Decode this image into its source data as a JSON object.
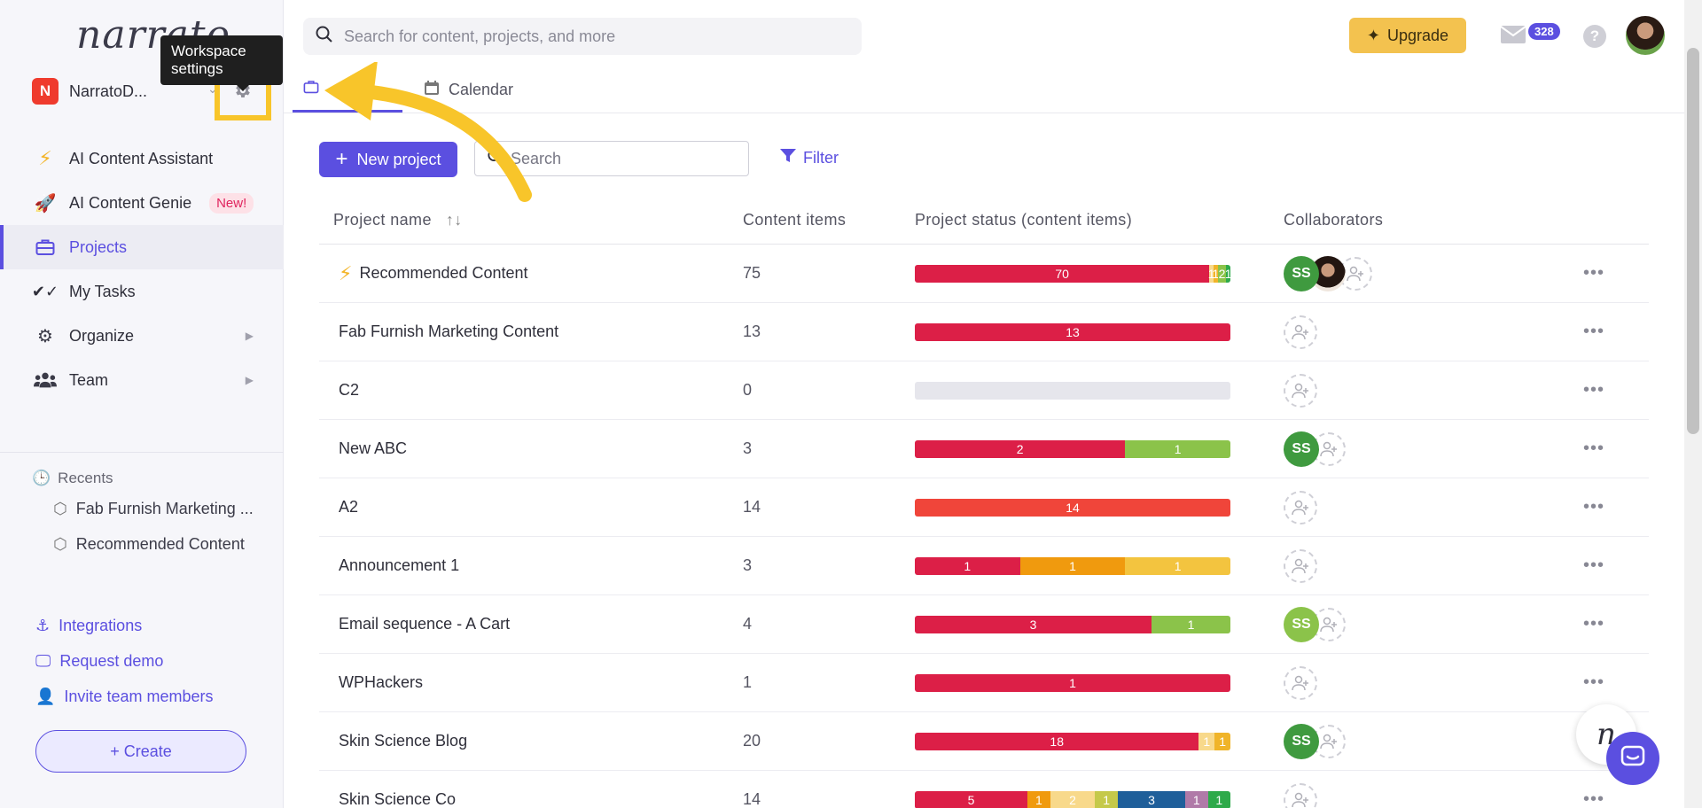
{
  "app": {
    "logo": "narrato"
  },
  "workspace": {
    "badge": "N",
    "name": "NarratoD...",
    "tooltip": "Workspace settings"
  },
  "sidebar": {
    "items": [
      {
        "label": "AI Content Assistant",
        "icon": "lightning-icon"
      },
      {
        "label": "AI Content Genie",
        "icon": "rocket-icon",
        "badge": "New!"
      },
      {
        "label": "Projects",
        "icon": "briefcase-icon",
        "active": true
      },
      {
        "label": "My Tasks",
        "icon": "checks-icon"
      },
      {
        "label": "Organize",
        "icon": "gears-icon"
      },
      {
        "label": "Team",
        "icon": "team-icon"
      }
    ],
    "recents_title": "Recents",
    "recents": [
      "Fab Furnish Marketing ...",
      "Recommended Content"
    ],
    "bottom_links": [
      "Integrations",
      "Request demo",
      "Invite team members"
    ],
    "create_label": "+ Create"
  },
  "topbar": {
    "search_placeholder": "Search for content, projects, and more",
    "upgrade_label": "Upgrade",
    "mail_count": "328",
    "help": "?"
  },
  "tabs": {
    "calendar": "Calendar"
  },
  "toolbar": {
    "new_project": "New project",
    "search_placeholder": "Search",
    "filter": "Filter"
  },
  "table": {
    "headers": {
      "name": "Project name",
      "count": "Content items",
      "status": "Project status (content items)",
      "collab": "Collaborators"
    },
    "rows": [
      {
        "name": "Recommended Content",
        "lightning": true,
        "count": "75",
        "segments": [
          {
            "v": 70,
            "label": "70",
            "color": "#dc1f47"
          },
          {
            "v": 1,
            "label": "1",
            "color": "#f8d98b"
          },
          {
            "v": 1,
            "label": "1",
            "color": "#f0b429"
          },
          {
            "v": 2,
            "label": "2",
            "color": "#8bc34a"
          },
          {
            "v": 1,
            "label": "1",
            "color": "#2eaa4a"
          }
        ],
        "collab": {
          "initials": "SS",
          "color": "#3f9a3f",
          "photo": true
        }
      },
      {
        "name": "Fab Furnish Marketing Content",
        "count": "13",
        "segments": [
          {
            "v": 13,
            "label": "13",
            "color": "#dc1f47"
          }
        ],
        "collab": null
      },
      {
        "name": "C2",
        "count": "0",
        "segments": [],
        "collab": null
      },
      {
        "name": "New ABC",
        "count": "3",
        "segments": [
          {
            "v": 2,
            "label": "2",
            "color": "#dc1f47"
          },
          {
            "v": 1,
            "label": "1",
            "color": "#8bc34a"
          }
        ],
        "collab": {
          "initials": "SS",
          "color": "#3f9a3f"
        }
      },
      {
        "name": "A2",
        "count": "14",
        "segments": [
          {
            "v": 14,
            "label": "14",
            "color": "#f0453a"
          }
        ],
        "collab": null
      },
      {
        "name": "Announcement 1",
        "count": "3",
        "segments": [
          {
            "v": 1,
            "label": "1",
            "color": "#dc1f47"
          },
          {
            "v": 1,
            "label": "1",
            "color": "#f09a0e"
          },
          {
            "v": 1,
            "label": "1",
            "color": "#f3c43f"
          }
        ],
        "collab": null
      },
      {
        "name": "Email sequence - A Cart",
        "count": "4",
        "segments": [
          {
            "v": 3,
            "label": "3",
            "color": "#dc1f47"
          },
          {
            "v": 1,
            "label": "1",
            "color": "#8bc34a"
          }
        ],
        "collab": {
          "initials": "SS",
          "color": "#8bc34a"
        }
      },
      {
        "name": "WPHackers",
        "count": "1",
        "segments": [
          {
            "v": 1,
            "label": "1",
            "color": "#dc1f47"
          }
        ],
        "collab": null
      },
      {
        "name": "Skin Science Blog",
        "count": "20",
        "segments": [
          {
            "v": 18,
            "label": "18",
            "color": "#dc1f47"
          },
          {
            "v": 1,
            "label": "1",
            "color": "#f8d98b"
          },
          {
            "v": 1,
            "label": "1",
            "color": "#f0b429"
          }
        ],
        "collab": {
          "initials": "SS",
          "color": "#3f9a3f"
        }
      },
      {
        "name": "Skin Science Co",
        "count": "14",
        "segments": [
          {
            "v": 5,
            "label": "5",
            "color": "#dc1f47"
          },
          {
            "v": 1,
            "label": "1",
            "color": "#f09a0e"
          },
          {
            "v": 2,
            "label": "2",
            "color": "#f8d98b"
          },
          {
            "v": 1,
            "label": "1",
            "color": "#c5c94a"
          },
          {
            "v": 3,
            "label": "3",
            "color": "#1f5f9a"
          },
          {
            "v": 1,
            "label": "1",
            "color": "#b07aa8"
          },
          {
            "v": 1,
            "label": "1",
            "color": "#2eaa4a"
          }
        ],
        "collab": null
      }
    ],
    "more": "•••"
  },
  "colors": {
    "accent": "#5b4fe0",
    "highlight": "#f8c52a",
    "upgrade": "#f3c24f"
  }
}
